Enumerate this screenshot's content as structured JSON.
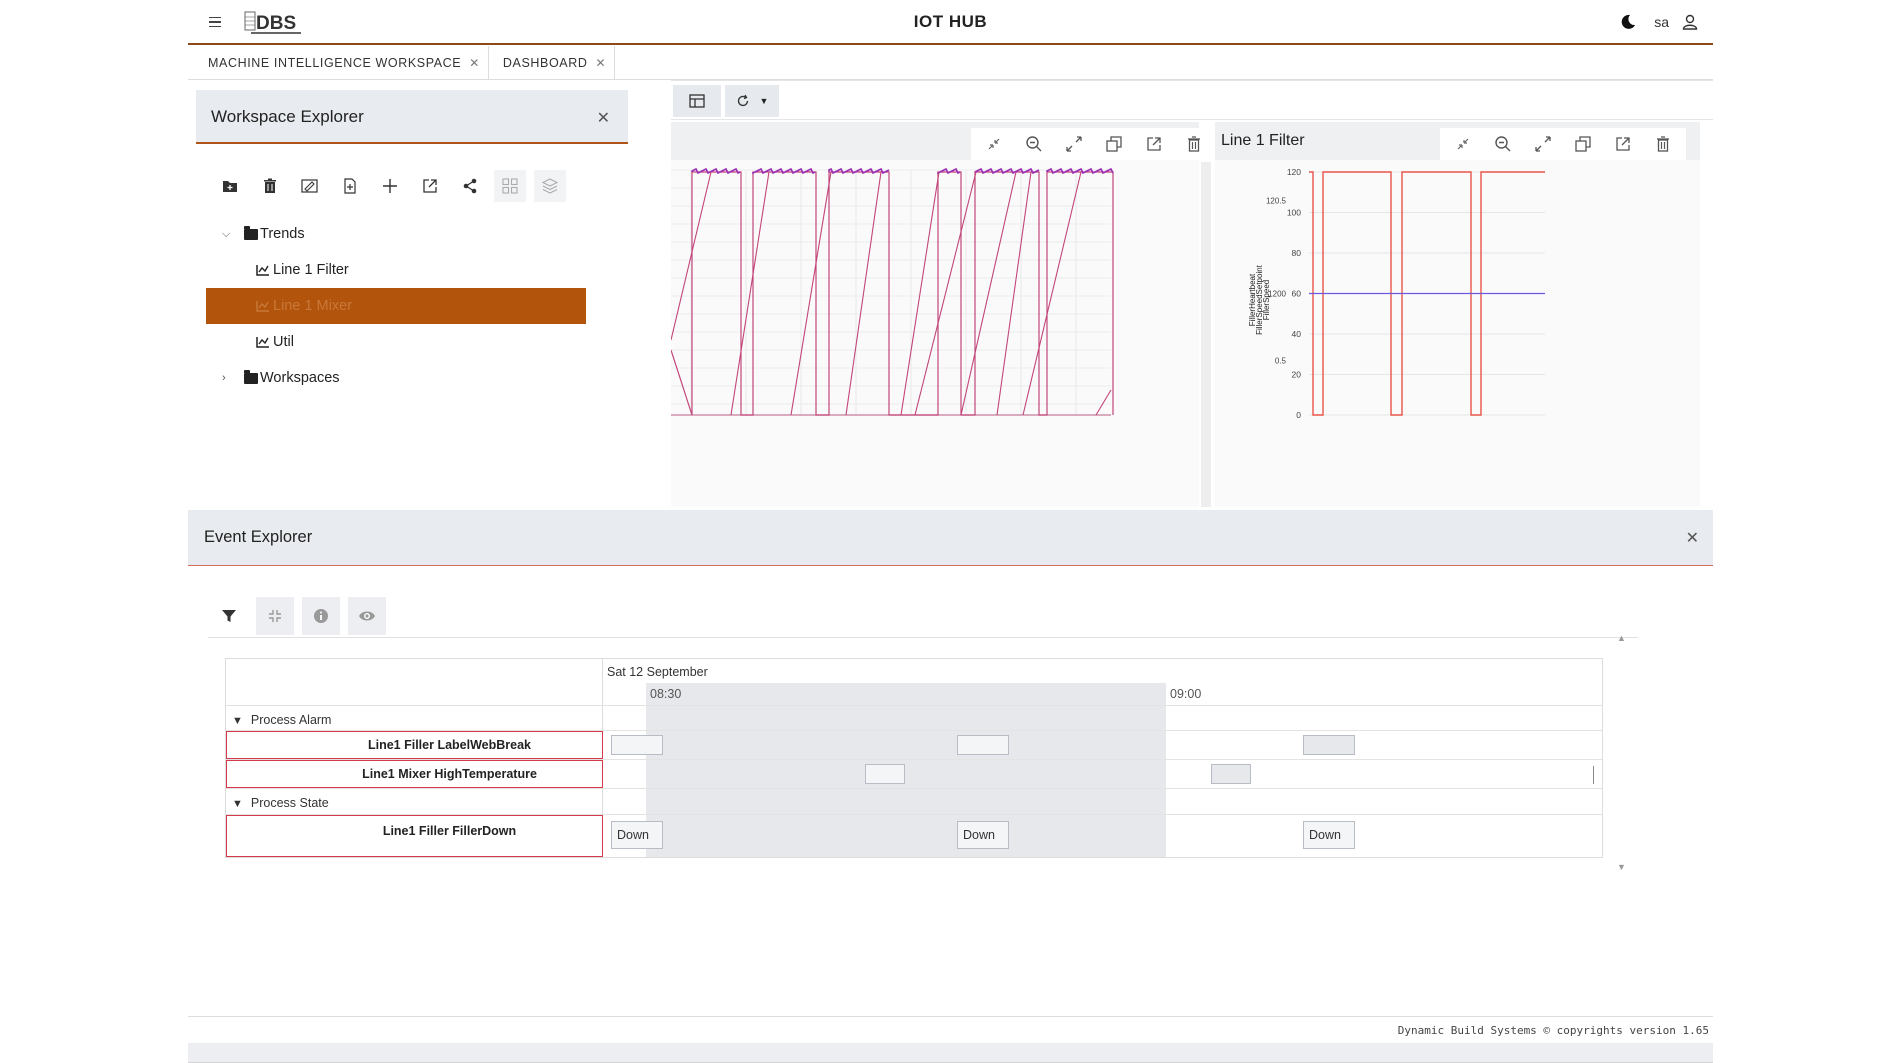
{
  "header": {
    "title": "IOT HUB",
    "user": "sa",
    "logo_text": "DBS"
  },
  "tabs": [
    {
      "label": "MACHINE INTELLIGENCE WORKSPACE"
    },
    {
      "label": "DASHBOARD"
    }
  ],
  "workspace_explorer": {
    "title": "Workspace Explorer",
    "tree": {
      "trends_label": "Trends",
      "trend_items": [
        "Line 1 Filter",
        "Line 1 Mixer",
        "Util"
      ],
      "selected_index": 1,
      "workspaces_label": "Workspaces"
    }
  },
  "charts": {
    "right_title": "Line 1 Filter",
    "right_axis_labels": [
      "FillerHeartbeat",
      "FillerSpeedSetpoint",
      "FillerSpeed"
    ]
  },
  "chart_data": [
    {
      "type": "line",
      "title": "",
      "series": [
        {
          "color": "#c2457a",
          "values": "sawtooth"
        },
        {
          "color": "#9b30b5",
          "values": "plateau"
        }
      ]
    },
    {
      "type": "line",
      "title": "Line 1 Filter",
      "yticks": [
        0,
        20,
        40,
        60,
        80,
        100,
        120
      ],
      "extra_tick_labels": [
        "120.5",
        "1200",
        "0.5"
      ],
      "ylim": [
        0,
        120
      ],
      "series": [
        {
          "color": "#e8544a",
          "pattern": "square wave 0-120"
        },
        {
          "color": "#6a5ae0",
          "value": 60
        }
      ]
    }
  ],
  "event_explorer": {
    "title": "Event Explorer",
    "date": "Sat 12 September",
    "ticks": [
      "08:30",
      "09:00"
    ],
    "groups": [
      {
        "label": "Process Alarm",
        "items": [
          "Line1 Filler LabelWebBreak",
          "Line1 Mixer HighTemperature"
        ]
      },
      {
        "label": "Process State",
        "items": [
          "Line1 Filler FillerDown"
        ]
      }
    ],
    "state_box_label": "Down"
  },
  "footer": {
    "text": "Dynamic Build Systems © copyrights version 1.65"
  },
  "colors": {
    "accent": "#b3540c",
    "alarm_border": "#d43a4a"
  }
}
